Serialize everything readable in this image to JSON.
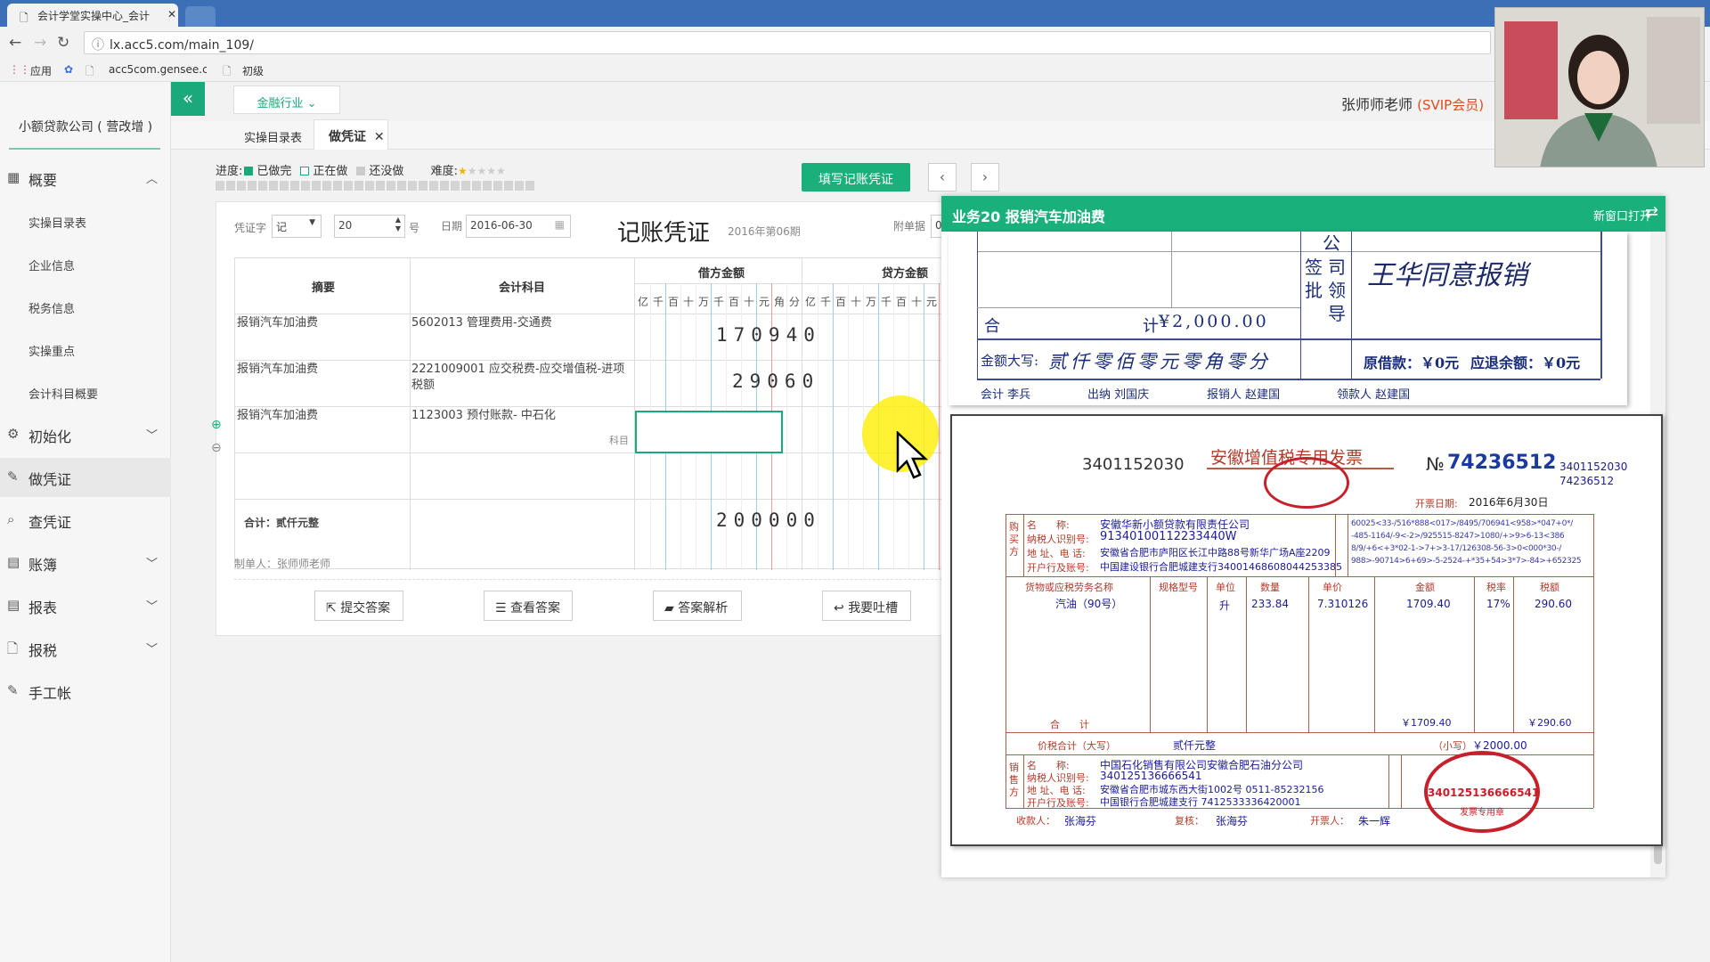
{
  "browser": {
    "tab_title": "会计学堂实操中心_会计",
    "url": "lx.acc5.com/main_109/",
    "bookmarks": [
      "应用",
      "acc5com.gensee.co",
      "初级"
    ]
  },
  "sidebar": {
    "company": "小额贷款公司 ( 营改增 )",
    "items": [
      {
        "label": "概要"
      },
      {
        "label": "初始化"
      },
      {
        "label": "做凭证"
      },
      {
        "label": "查凭证"
      },
      {
        "label": "账簿"
      },
      {
        "label": "报表"
      },
      {
        "label": "报税"
      },
      {
        "label": "手工帐"
      }
    ],
    "sub_items": [
      "实操目录表",
      "企业信息",
      "税务信息",
      "实操重点",
      "会计科目概要"
    ]
  },
  "header": {
    "industry": "金融行业",
    "user_name": "张师师老师",
    "vip": "(SVIP会员)"
  },
  "tabs": {
    "catalog": "实操目录表",
    "active": "做凭证"
  },
  "progress": {
    "label": "进度:",
    "done": "已做完",
    "doing": "正在做",
    "todo": "还没做",
    "difficulty": "难度:",
    "done_count": 20,
    "total": 30
  },
  "toolbar": {
    "fill_voucher": "填写记账凭证"
  },
  "voucher": {
    "word_label": "凭证字",
    "word": "记",
    "number": "20",
    "number_unit": "号",
    "date_label": "日期",
    "date": "2016-06-30",
    "title": "记账凭证",
    "period": "2016年第06期",
    "attach_label": "附单据",
    "attach_value": "0",
    "col_summary": "摘要",
    "col_account": "会计科目",
    "col_debit": "借方金额",
    "col_credit": "贷方金额",
    "units": [
      "亿",
      "千",
      "百",
      "十",
      "万",
      "千",
      "百",
      "十",
      "元",
      "角",
      "分"
    ],
    "rows": [
      {
        "summary": "报销汽车加油费",
        "account": "5602013 管理费用-交通费",
        "debit": "170940"
      },
      {
        "summary": "报销汽车加油费",
        "account": "2221009001 应交税费-应交增值税-进项税额",
        "debit": "29060"
      },
      {
        "summary": "报销汽车加油费",
        "account": "1123003 预付账款- 中石化",
        "debit": "",
        "hint": "科目"
      }
    ],
    "total_label": "合计：贰仟元整",
    "total_debit": "200000",
    "maker": "制单人：张师师老师",
    "buttons": [
      "提交答案",
      "查看答案",
      "答案解析",
      "我要吐槽"
    ]
  },
  "panel": {
    "title": "业务20 报销汽车加油费",
    "open_new": "新窗口打开"
  },
  "reimbursement": {
    "approve_chars": [
      "公",
      "司",
      "签",
      "领",
      "批",
      "导"
    ],
    "approval": "王华同意报销",
    "total_label": "合",
    "total_label2": "计",
    "total_amount": "¥2,000.00",
    "amount_words_label": "金额大写:",
    "amount_words": "贰仟零佰零元零角零分",
    "borrowed": "原借款：￥0元",
    "refund": "应退余额：￥0元",
    "signers": [
      "会计 李兵",
      "出纳 刘国庆",
      "报销人 赵建国",
      "领款人 赵建国"
    ]
  },
  "invoice": {
    "code": "3401152030",
    "title": "安徽增值税专用发票",
    "no_label": "№",
    "no": "74236512",
    "code_right": "3401152030",
    "no_right": "74236512",
    "date_label": "开票日期:",
    "date": "2016年6月30日",
    "buyer": {
      "name": "安徽华新小额贷款有限责任公司",
      "tax_id": "91340100112233440W",
      "address": "安徽省合肥市庐阳区长江中路88号新华广场A座2209",
      "bank": "中国建设银行合肥城建支行34001468608044253385"
    },
    "cipher": [
      "60025<33-/516*888<017>/8495/706941<958>*047+0*/",
      "-485-1164/-9<-2>/925515-8247>1080/+>9>6-13<386",
      "8/9/+6<+3*02-1->7+>3-17/126308-56-3>0<000*30-/",
      "988>-90714>6+69>-5-2524-+*35+54>3*7>-84>+652325"
    ],
    "headers": [
      "货物或应税劳务名称",
      "规格型号",
      "单位",
      "数量",
      "单价",
      "金额",
      "税率",
      "税额"
    ],
    "item": {
      "name": "汽油（90号）",
      "unit": "升",
      "qty": "233.84",
      "price": "7.310126",
      "amount": "1709.40",
      "rate": "17%",
      "tax": "290.60"
    },
    "sum_label": "合　　计",
    "sum_amount": "￥1709.40",
    "sum_tax": "￥290.60",
    "total_words_label": "价税合计（大写）",
    "total_words": "贰仟元整",
    "total_small_label": "（小写）",
    "total_small": "￥2000.00",
    "seller": {
      "name": "中国石化销售有限公司安徽合肥石油分公司",
      "tax_id": "340125136666541",
      "address": "安徽省合肥市城东西大街1002号 0511-85232156",
      "bank": "中国银行合肥城建支行 7412533336420001"
    },
    "payee_label": "收款人：",
    "payee": "张海芬",
    "checker_label": "复核：",
    "checker": "张海芬",
    "drawer_label": "开票人：",
    "drawer": "朱一辉",
    "stamp_text": "340125136666541",
    "stamp_sub": "发票专用章",
    "field_labels": [
      "名　　称:",
      "纳税人识别号:",
      "地 址、电 话:",
      "开户行及账号:"
    ]
  }
}
